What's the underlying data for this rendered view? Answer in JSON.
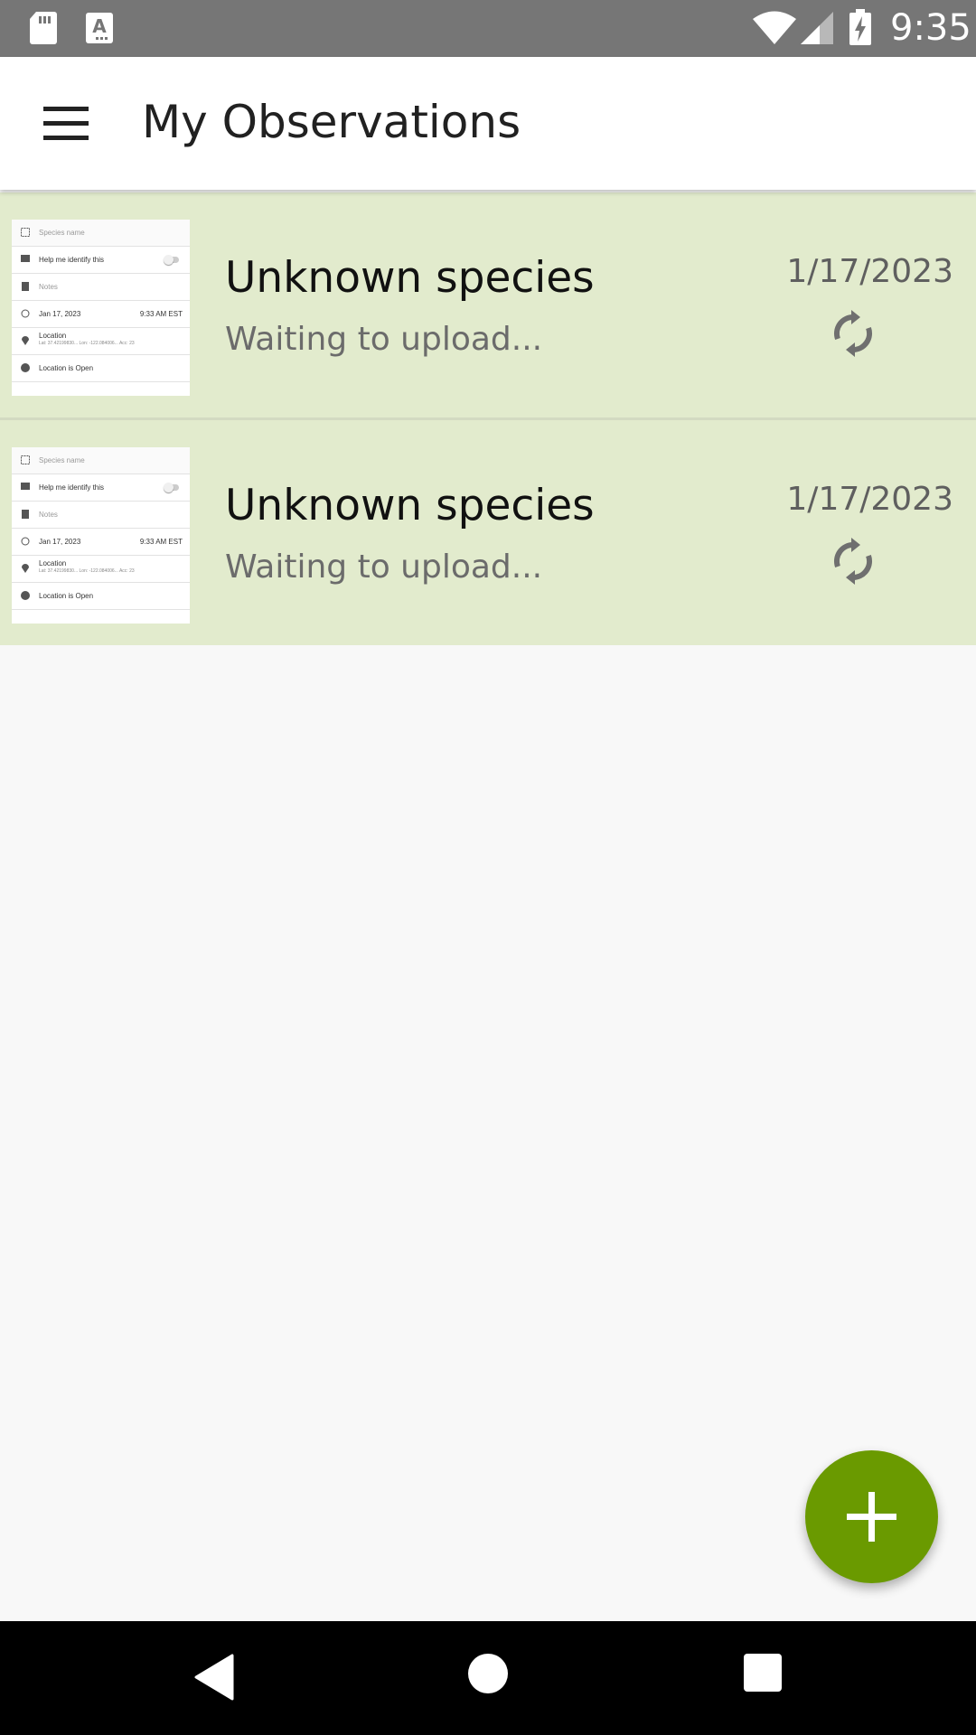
{
  "status_bar": {
    "time": "9:35",
    "icons": [
      "sd-card-icon",
      "keyboard-a-icon",
      "wifi-icon",
      "cell-signal-icon",
      "battery-charging-icon"
    ]
  },
  "app_bar": {
    "title": "My Observations",
    "menu_icon": "hamburger-menu-icon"
  },
  "observations": [
    {
      "title": "Unknown species",
      "status": "Waiting to upload...",
      "date": "1/17/2023",
      "icon": "sync-icon",
      "thumbnail": {
        "species_name": "Species name",
        "help_label": "Help me identify this",
        "notes": "Notes",
        "date": "Jan 17, 2023",
        "time": "9:33 AM EST",
        "location_label": "Location",
        "location_detail": "Lat: 37.42199830... Lon: -122.084006... Acc: 23",
        "location_visibility": "Location is Open"
      }
    },
    {
      "title": "Unknown species",
      "status": "Waiting to upload...",
      "date": "1/17/2023",
      "icon": "sync-icon",
      "thumbnail": {
        "species_name": "Species name",
        "help_label": "Help me identify this",
        "notes": "Notes",
        "date": "Jan 17, 2023",
        "time": "9:33 AM EST",
        "location_label": "Location",
        "location_detail": "Lat: 37.42199830... Lon: -122.084006... Acc: 23",
        "location_visibility": "Location is Open"
      }
    }
  ],
  "fab": {
    "icon": "plus-icon"
  },
  "nav_bar": {
    "icons": [
      "back-icon",
      "home-icon",
      "recents-icon"
    ]
  },
  "colors": {
    "status_bar": "#767676",
    "row_background": "#e2ebcd",
    "fab": "#6a9a00",
    "nav_bar": "#000000"
  }
}
